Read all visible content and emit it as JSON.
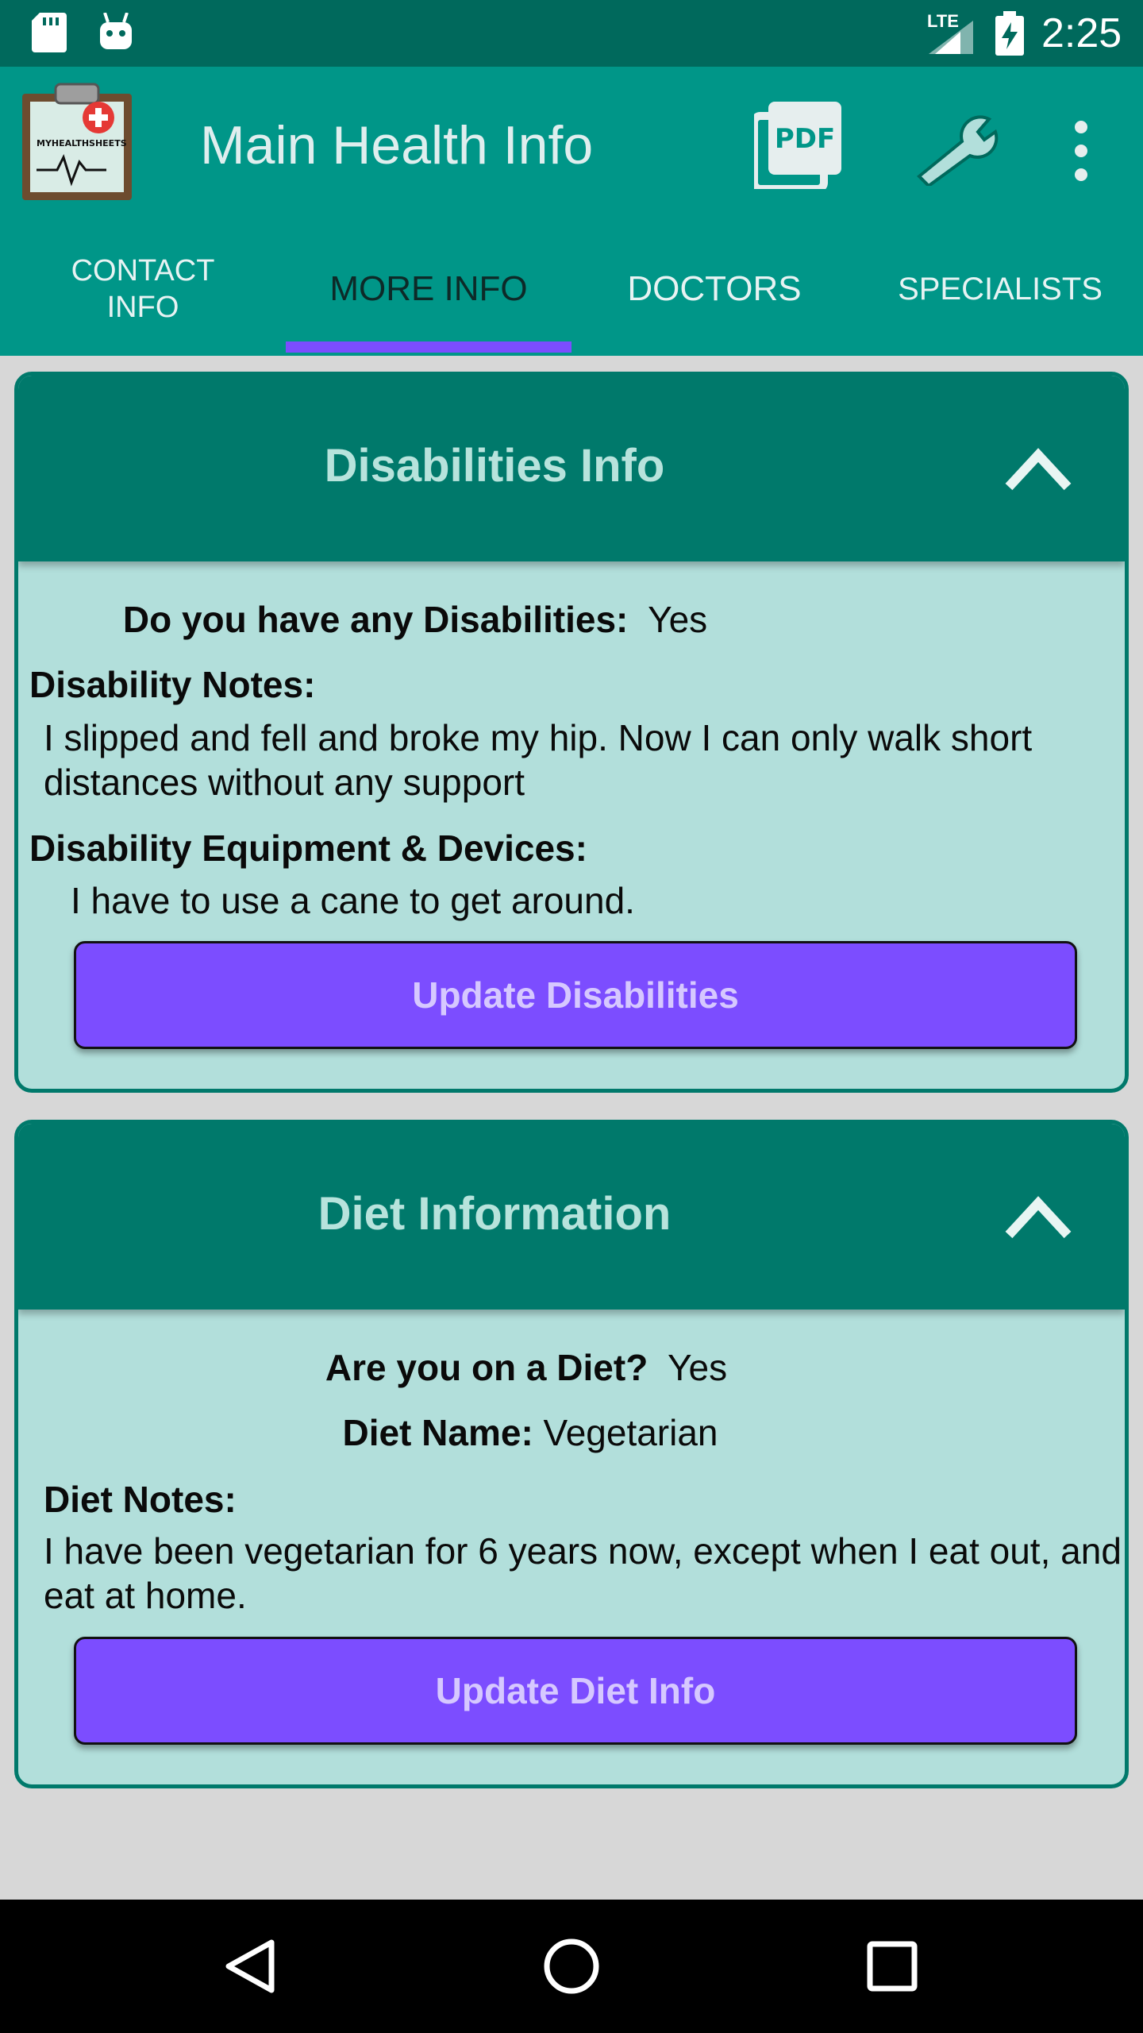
{
  "status_bar": {
    "network": "LTE",
    "time": "2:25",
    "icons": [
      "sd-card-icon",
      "android-icon",
      "signal-icon",
      "battery-charging-icon"
    ]
  },
  "app_bar": {
    "title": "Main Health Info",
    "logo_text": "MYHEALTHSHEETS",
    "pdf_label": "PDF",
    "icons": [
      "app-logo-icon",
      "pdf-icon",
      "wrench-icon",
      "more-vert-icon"
    ]
  },
  "tabs": [
    {
      "label": "CONTACT\nINFO",
      "active": false
    },
    {
      "label": "MORE INFO",
      "active": true
    },
    {
      "label": "DOCTORS",
      "active": false
    },
    {
      "label": "SPECIALISTS",
      "active": false
    }
  ],
  "disabilities": {
    "title": "Disabilities Info",
    "question_label": "Do you have any Disabilities:",
    "question_value": "Yes",
    "notes_label": "Disability Notes:",
    "notes_value": "I slipped and fell and broke my hip.  Now I can only walk short distances without any support",
    "equipment_label": "Disability Equipment & Devices:",
    "equipment_value": "I have to use a cane to get around.",
    "button": "Update Disabilities"
  },
  "diet": {
    "title": "Diet Information",
    "question_label": "Are you on a Diet?",
    "question_value": "Yes",
    "name_label": "Diet Name:",
    "name_value": "Vegetarian",
    "notes_label": "Diet Notes:",
    "notes_value": "I have been vegetarian for 6 years now, except when I eat out, and eat at home.",
    "button": "Update Diet Info"
  },
  "colors": {
    "primary_dark": "#00695c",
    "primary": "#009688",
    "card_header": "#00796b",
    "card_body": "#b2dfdb",
    "accent": "#7c4dff"
  }
}
